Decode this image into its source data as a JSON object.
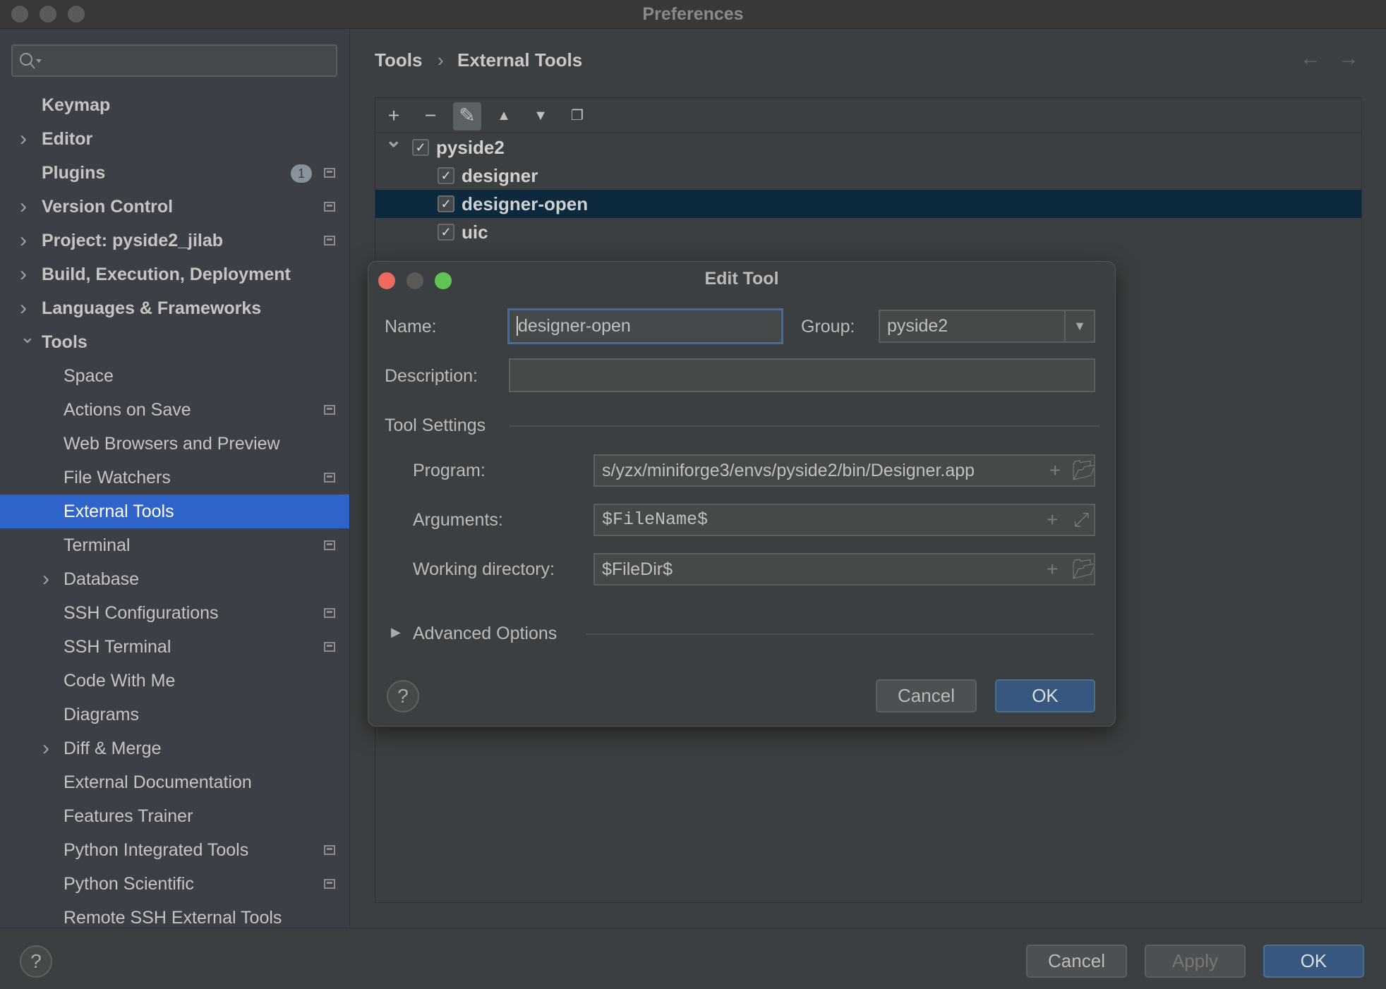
{
  "window": {
    "title": "Preferences"
  },
  "sidebar": {
    "search_placeholder": "",
    "items": [
      {
        "label": "Keymap",
        "level": 0,
        "chevron": "none"
      },
      {
        "label": "Editor",
        "level": 0,
        "chevron": "collapsed"
      },
      {
        "label": "Plugins",
        "level": 0,
        "chevron": "none",
        "badge": "1",
        "project_icon": true
      },
      {
        "label": "Version Control",
        "level": 0,
        "chevron": "collapsed",
        "project_icon": true
      },
      {
        "label": "Project: pyside2_jilab",
        "level": 0,
        "chevron": "collapsed",
        "project_icon": true
      },
      {
        "label": "Build, Execution, Deployment",
        "level": 0,
        "chevron": "collapsed"
      },
      {
        "label": "Languages & Frameworks",
        "level": 0,
        "chevron": "collapsed"
      },
      {
        "label": "Tools",
        "level": 0,
        "chevron": "expanded"
      },
      {
        "label": "Space",
        "level": 1,
        "chevron": "none"
      },
      {
        "label": "Actions on Save",
        "level": 1,
        "chevron": "none",
        "project_icon": true
      },
      {
        "label": "Web Browsers and Preview",
        "level": 1,
        "chevron": "none"
      },
      {
        "label": "File Watchers",
        "level": 1,
        "chevron": "none",
        "project_icon": true
      },
      {
        "label": "External Tools",
        "level": 1,
        "chevron": "none",
        "selected": true
      },
      {
        "label": "Terminal",
        "level": 1,
        "chevron": "none",
        "project_icon": true
      },
      {
        "label": "Database",
        "level": 1,
        "chevron": "collapsed"
      },
      {
        "label": "SSH Configurations",
        "level": 1,
        "chevron": "none",
        "project_icon": true
      },
      {
        "label": "SSH Terminal",
        "level": 1,
        "chevron": "none",
        "project_icon": true
      },
      {
        "label": "Code With Me",
        "level": 1,
        "chevron": "none"
      },
      {
        "label": "Diagrams",
        "level": 1,
        "chevron": "none"
      },
      {
        "label": "Diff & Merge",
        "level": 1,
        "chevron": "collapsed"
      },
      {
        "label": "External Documentation",
        "level": 1,
        "chevron": "none"
      },
      {
        "label": "Features Trainer",
        "level": 1,
        "chevron": "none"
      },
      {
        "label": "Python Integrated Tools",
        "level": 1,
        "chevron": "none",
        "project_icon": true
      },
      {
        "label": "Python Scientific",
        "level": 1,
        "chevron": "none",
        "project_icon": true
      },
      {
        "label": "Remote SSH External Tools",
        "level": 1,
        "chevron": "none"
      }
    ]
  },
  "breadcrumb": {
    "parent": "Tools",
    "sep": "›",
    "current": "External Tools",
    "back_icon": "arrow-left-icon",
    "forward_icon": "arrow-right-icon"
  },
  "toolbar": {
    "icons": [
      "plus-icon",
      "minus-icon",
      "pencil-icon",
      "arrow-up-icon",
      "arrow-down-icon",
      "copy-icon"
    ],
    "glyphs": [
      "+",
      "−",
      "✎",
      "▲",
      "▼",
      "❐"
    ]
  },
  "tree": [
    {
      "label": "pyside2",
      "checked": true,
      "group": true,
      "expanded": true
    },
    {
      "label": "designer",
      "checked": true
    },
    {
      "label": "designer-open",
      "checked": true,
      "selected": true
    },
    {
      "label": "uic",
      "checked": true
    }
  ],
  "dialog": {
    "title": "Edit Tool",
    "name_label": "Name:",
    "name_value": "designer-open",
    "group_label": "Group:",
    "group_value": "pyside2",
    "description_label": "Description:",
    "description_value": "",
    "tool_settings": "Tool Settings",
    "program_label": "Program:",
    "program_value": "s/yzx/miniforge3/envs/pyside2/bin/Designer.app",
    "arguments_label": "Arguments:",
    "arguments_value": "$FileName$",
    "workdir_label": "Working directory:",
    "workdir_value": "$FileDir$",
    "advanced": "Advanced Options",
    "help": "?",
    "cancel": "Cancel",
    "ok": "OK"
  },
  "footer": {
    "help": "?",
    "cancel": "Cancel",
    "apply": "Apply",
    "ok": "OK"
  },
  "colors": {
    "selection": "#2f65ca",
    "tree_selection": "#0d293e",
    "default_button": "#365880",
    "close": "#ed6a5e",
    "zoom": "#61c554"
  }
}
